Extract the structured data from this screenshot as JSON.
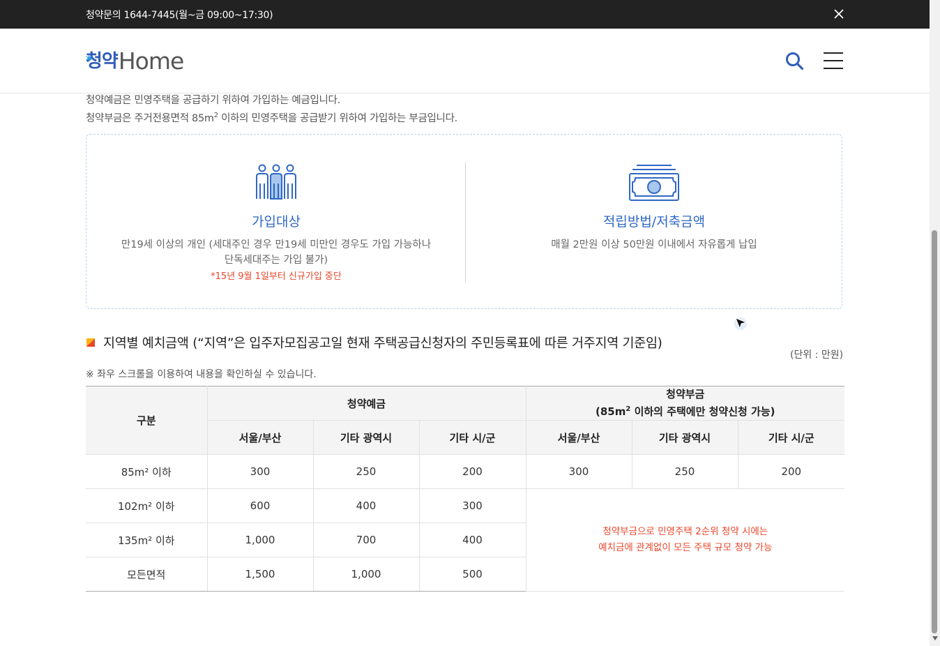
{
  "topbar": {
    "phone": "청약문의 1644-7445(월~금 09:00~17:30)"
  },
  "header": {
    "logo_ko": "청약",
    "logo_en": "Home"
  },
  "intro": {
    "line1": "청약예금은 민영주택을 공급하기 위하여 가입하는 예금입니다.",
    "line2_a": "청약부금은 주거전용면적 85m",
    "line2_sup": "2",
    "line2_b": " 이하의 민영주택을 공급받기 위하여 가입하는 부금입니다."
  },
  "info": {
    "left": {
      "title": "가입대상",
      "line1": "만19세 이상의 개인 (세대주인 경우 만19세 미만인 경우도 가입 가능하나",
      "line2": "단독세대주는 가입 불가)",
      "note": "*15년 9월 1일부터 신규가입 중단"
    },
    "right": {
      "title": "적립방법/저축금액",
      "desc": "매월 2만원 이상 50만원 이내에서 자유롭게 납입"
    }
  },
  "section": {
    "title": "지역별 예치금액 (“지역”은 입주자모집공고일 현재 주택공급신청자의 주민등록표에 따른 거주지역 기준임)",
    "unit": "(단위 : 만원)",
    "scroll_note": "※ 좌우 스크롤을 이용하여 내용을 확인하실 수 있습니다."
  },
  "table": {
    "h_category": "구분",
    "h_deposit": "청약예금",
    "h_install_1": "청약부금",
    "h_install_2a": "(85m",
    "h_install_2sup": "2",
    "h_install_2b": " 이하의 주택에만 청약신청 가능)",
    "sub": [
      "서울/부산",
      "기타 광역시",
      "기타 시/군",
      "서울/부산",
      "기타 광역시",
      "기타 시/군"
    ],
    "rows": [
      {
        "label": "85m² 이하",
        "values": [
          "300",
          "250",
          "200",
          "300",
          "250",
          "200"
        ]
      },
      {
        "label": "102m² 이하",
        "values": [
          "600",
          "400",
          "300"
        ]
      },
      {
        "label": "135m² 이하",
        "values": [
          "1,000",
          "700",
          "400"
        ]
      },
      {
        "label": "모든면적",
        "values": [
          "1,500",
          "1,000",
          "500"
        ]
      }
    ],
    "note_line1": "청약부금으로 민영주택 2순위 청약 시에는",
    "note_line2": "예치금에 관계없이 모든 주택 규모 청약 가능"
  },
  "colors": {
    "accent": "#2f68c4",
    "warning": "#e8472b",
    "topbar": "#222222"
  }
}
